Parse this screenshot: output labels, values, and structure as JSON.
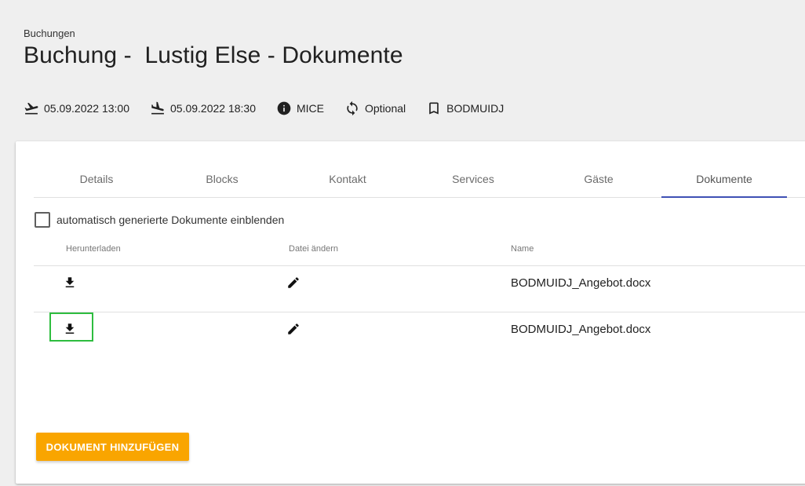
{
  "header": {
    "breadcrumb": "Buchungen",
    "title": "Buchung -  Lustig Else - Dokumente",
    "meta": [
      {
        "icon": "flight-takeoff-icon",
        "text": "05.09.2022 13:00"
      },
      {
        "icon": "flight-land-icon",
        "text": "05.09.2022 18:30"
      },
      {
        "icon": "info-icon",
        "text": "MICE"
      },
      {
        "icon": "restore-icon",
        "text": "Optional"
      },
      {
        "icon": "bookmark-icon",
        "text": "BODMUIDJ"
      }
    ]
  },
  "tabs": [
    {
      "label": "Details"
    },
    {
      "label": "Blocks"
    },
    {
      "label": "Kontakt"
    },
    {
      "label": "Services"
    },
    {
      "label": "Gäste"
    },
    {
      "label": "Dokumente",
      "active": true
    }
  ],
  "filter": {
    "label": "automatisch generierte Dokumente einblenden",
    "checked": false
  },
  "table": {
    "columns": [
      "Herunterladen",
      "Datei ändern",
      "Name"
    ],
    "rows": [
      {
        "name": "BODMUIDJ_Angebot.docx"
      },
      {
        "name": "BODMUIDJ_Angebot.docx"
      }
    ]
  },
  "actions": {
    "add_document": "DOKUMENT HINZUFÜGEN"
  },
  "colors": {
    "accent": "#f9a500",
    "tab_indicator": "#3f51b5",
    "highlight": "#2ebd3f",
    "background": "#efefef"
  }
}
